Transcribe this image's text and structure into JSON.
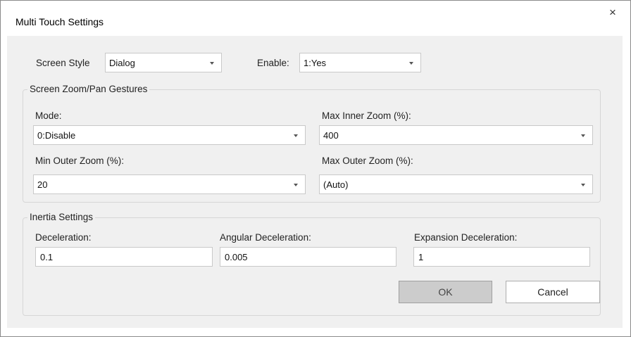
{
  "window": {
    "title": "Multi Touch Settings",
    "close_glyph": "×"
  },
  "top": {
    "screen_style_label": "Screen Style",
    "screen_style_value": "Dialog",
    "enable_label": "Enable:",
    "enable_value": "1:Yes"
  },
  "zoom_group": {
    "title": "Screen Zoom/Pan Gestures",
    "mode_label": "Mode:",
    "mode_value": "0:Disable",
    "max_inner_label": "Max Inner Zoom (%):",
    "max_inner_value": "400",
    "min_outer_label": "Min Outer Zoom (%):",
    "min_outer_value": "20",
    "max_outer_label": "Max Outer Zoom (%):",
    "max_outer_value": "(Auto)"
  },
  "inertia_group": {
    "title": "Inertia Settings",
    "deceleration_label": "Deceleration:",
    "deceleration_value": "0.1",
    "angular_label": "Angular Deceleration:",
    "angular_value": "0.005",
    "expansion_label": "Expansion Deceleration:",
    "expansion_value": "1"
  },
  "buttons": {
    "ok": "OK",
    "cancel": "Cancel"
  }
}
